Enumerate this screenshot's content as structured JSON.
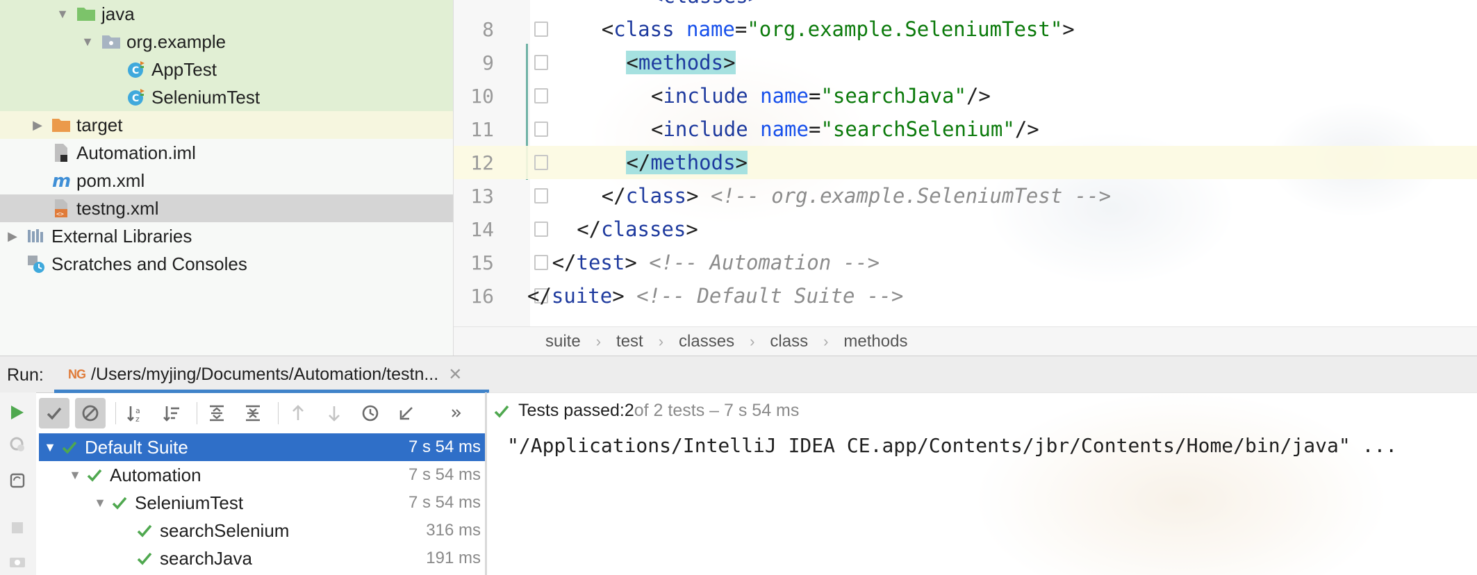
{
  "project_tree": [
    {
      "label": "java",
      "icon": "folder-green-icon",
      "depth": 2,
      "arrow": "down",
      "state": "green"
    },
    {
      "label": "org.example",
      "icon": "package-icon",
      "depth": 3,
      "arrow": "down",
      "state": "green"
    },
    {
      "label": "AppTest",
      "icon": "test-class-icon",
      "depth": 4,
      "arrow": "",
      "state": "green"
    },
    {
      "label": "SeleniumTest",
      "icon": "test-class-icon",
      "depth": 4,
      "arrow": "",
      "state": "green"
    },
    {
      "label": "target",
      "icon": "folder-orange-icon",
      "depth": 1,
      "arrow": "right",
      "state": "yellow"
    },
    {
      "label": "Automation.iml",
      "icon": "iml-file-icon",
      "depth": 1,
      "arrow": "",
      "state": ""
    },
    {
      "label": "pom.xml",
      "icon": "maven-icon",
      "depth": 1,
      "arrow": "",
      "state": ""
    },
    {
      "label": "testng.xml",
      "icon": "xml-file-icon",
      "depth": 1,
      "arrow": "",
      "state": "selected"
    },
    {
      "label": "External Libraries",
      "icon": "libraries-icon",
      "depth": 0,
      "arrow": "right",
      "state": ""
    },
    {
      "label": "Scratches and Consoles",
      "icon": "scratches-icon",
      "depth": 0,
      "arrow": "",
      "state": ""
    }
  ],
  "editor": {
    "lines": [
      {
        "no": "8",
        "indent": 6,
        "tokens": [
          [
            "br",
            "<"
          ],
          [
            "tag",
            "class"
          ],
          [
            "sp",
            " "
          ],
          [
            "attr",
            "name"
          ],
          [
            "br",
            "="
          ],
          [
            "val",
            "\"org.example.SeleniumTest\""
          ],
          [
            "br",
            ">"
          ]
        ]
      },
      {
        "no": "9",
        "indent": 8,
        "tokens": [
          [
            "hl",
            "<"
          ],
          [
            "hltag",
            "methods"
          ],
          [
            "hl",
            ">"
          ]
        ]
      },
      {
        "no": "10",
        "indent": 10,
        "tokens": [
          [
            "br",
            "<"
          ],
          [
            "tag",
            "include"
          ],
          [
            "sp",
            " "
          ],
          [
            "attr",
            "name"
          ],
          [
            "br",
            "="
          ],
          [
            "val",
            "\"searchJava\""
          ],
          [
            "br",
            "/>"
          ]
        ]
      },
      {
        "no": "11",
        "indent": 10,
        "tokens": [
          [
            "br",
            "<"
          ],
          [
            "tag",
            "include"
          ],
          [
            "sp",
            " "
          ],
          [
            "attr",
            "name"
          ],
          [
            "br",
            "="
          ],
          [
            "val",
            "\"searchSelenium\""
          ],
          [
            "br",
            "/>"
          ]
        ]
      },
      {
        "no": "12",
        "indent": 8,
        "tokens": [
          [
            "hl",
            "</"
          ],
          [
            "hltag",
            "methods"
          ],
          [
            "hl",
            ">"
          ]
        ],
        "current": true
      },
      {
        "no": "13",
        "indent": 6,
        "tokens": [
          [
            "br",
            "</"
          ],
          [
            "tag",
            "class"
          ],
          [
            "br",
            ">"
          ],
          [
            "sp",
            " "
          ],
          [
            "com",
            "<!-- org.example.SeleniumTest -->"
          ]
        ]
      },
      {
        "no": "14",
        "indent": 4,
        "tokens": [
          [
            "br",
            "</"
          ],
          [
            "tag",
            "classes"
          ],
          [
            "br",
            ">"
          ]
        ]
      },
      {
        "no": "15",
        "indent": 2,
        "tokens": [
          [
            "br",
            "</"
          ],
          [
            "tag",
            "test"
          ],
          [
            "br",
            ">"
          ],
          [
            "sp",
            " "
          ],
          [
            "com",
            "<!-- Automation -->"
          ]
        ]
      },
      {
        "no": "16",
        "indent": 0,
        "tokens": [
          [
            "br",
            "</"
          ],
          [
            "tag",
            "suite"
          ],
          [
            "br",
            ">"
          ],
          [
            "sp",
            " "
          ],
          [
            "com",
            "<!-- Default Suite -->"
          ]
        ]
      }
    ],
    "partial_top_line": "<classes>"
  },
  "breadcrumbs": [
    "suite",
    "test",
    "classes",
    "class",
    "methods"
  ],
  "run": {
    "label": "Run:",
    "tab_badge": "NG",
    "tab_title": "/Users/myjing/Documents/Automation/testn...",
    "close": "✕"
  },
  "test_tree": [
    {
      "label": "Default Suite",
      "duration": "7 s 54 ms",
      "depth": 0,
      "arrow": "down",
      "selected": true
    },
    {
      "label": "Automation",
      "duration": "7 s 54 ms",
      "depth": 1,
      "arrow": "down",
      "selected": false
    },
    {
      "label": "SeleniumTest",
      "duration": "7 s 54 ms",
      "depth": 2,
      "arrow": "down",
      "selected": false
    },
    {
      "label": "searchSelenium",
      "duration": "316 ms",
      "depth": 3,
      "arrow": "",
      "selected": false
    },
    {
      "label": "searchJava",
      "duration": "191 ms",
      "depth": 3,
      "arrow": "",
      "selected": false
    }
  ],
  "console": {
    "status_prefix": "Tests passed: ",
    "passed_count": "2",
    "status_suffix": " of 2 tests – 7 s 54 ms",
    "command_line": "\"/Applications/IntelliJ IDEA CE.app/Contents/jbr/Contents/Home/bin/java\" ..."
  },
  "colors": {
    "accent": "#2f6fc8",
    "pass_green": "#4fa84f",
    "tab_underline": "#4083c9"
  }
}
